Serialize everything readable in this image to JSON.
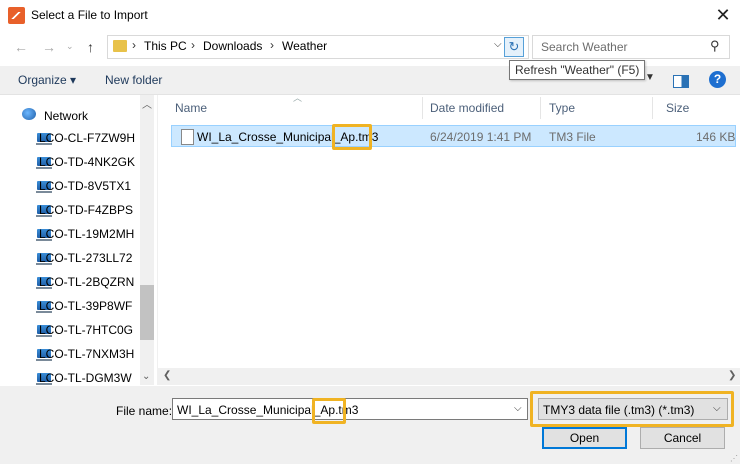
{
  "window": {
    "title": "Select a File to Import",
    "close": "✕"
  },
  "address": {
    "crumbs": [
      "This PC",
      "Downloads",
      "Weather"
    ],
    "search_placeholder": "Search Weather",
    "tooltip": "Refresh \"Weather\" (F5)"
  },
  "toolbar": {
    "organize": "Organize ▾",
    "new_folder": "New folder"
  },
  "nav": {
    "network": "Network",
    "items": [
      "LCO-CL-F7ZW9H",
      "LCO-TD-4NK2GK",
      "LCO-TD-8V5TX1",
      "LCO-TD-F4ZBPS",
      "LCO-TL-19M2MH",
      "LCO-TL-273LL72",
      "LCO-TL-2BQZRN",
      "LCO-TL-39P8WF",
      "LCO-TL-7HTC0G",
      "LCO-TL-7NXM3H",
      "LCO-TL-DGM3W"
    ]
  },
  "list": {
    "columns": [
      "Name",
      "Date modified",
      "Type",
      "Size"
    ],
    "rows": [
      {
        "name": "WI_La_Crosse_Municipal_Ap.tm3",
        "date": "6/24/2019 1:41 PM",
        "type": "TM3 File",
        "size": "146 KB"
      }
    ]
  },
  "bottom": {
    "file_name_label": "File name:",
    "file_name_value": "WI_La_Crosse_Municipal_Ap.tm3",
    "file_type_value": "TMY3 data file (.tm3)  (*.tm3)",
    "open": "Open",
    "cancel": "Cancel"
  },
  "colors": {
    "highlight": "#f0b323",
    "selection": "#cce8ff",
    "accent": "#0078d7"
  }
}
